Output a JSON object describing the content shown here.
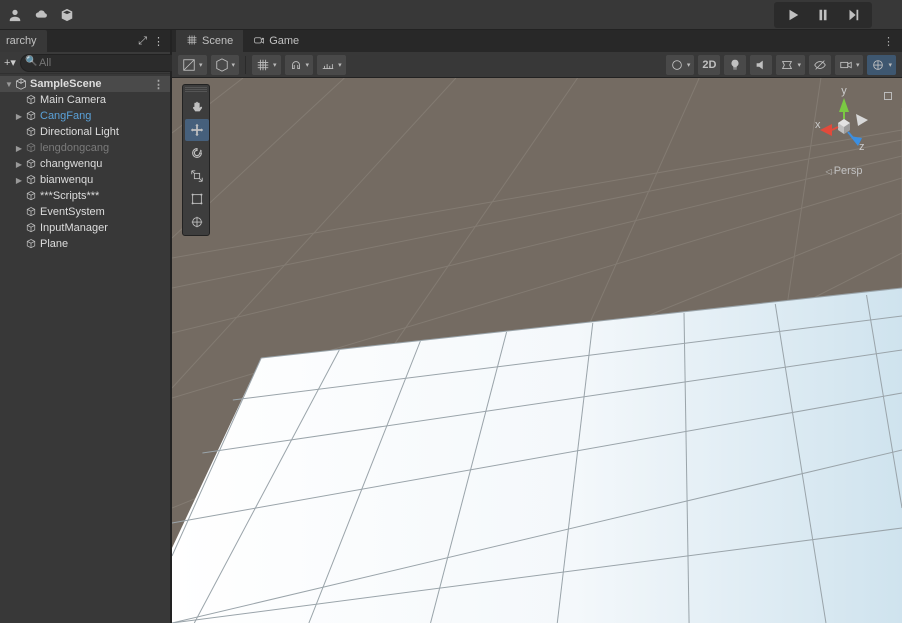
{
  "topbar": {
    "buttons": [
      "account",
      "cloud",
      "package"
    ],
    "play": "play",
    "pause": "pause",
    "step": "step"
  },
  "hierarchy": {
    "tab_label": "rarchy",
    "search_placeholder": "All",
    "scene_name": "SampleScene",
    "items": [
      {
        "label": "Main Camera",
        "state": "normal"
      },
      {
        "label": "CangFang",
        "state": "selected",
        "expandable": true
      },
      {
        "label": "Directional Light",
        "state": "normal"
      },
      {
        "label": "lengdongcang",
        "state": "dim",
        "expandable": true
      },
      {
        "label": "changwenqu",
        "state": "normal",
        "expandable": true
      },
      {
        "label": "bianwenqu",
        "state": "normal",
        "expandable": true
      },
      {
        "label": "***Scripts***",
        "state": "normal"
      },
      {
        "label": "EventSystem",
        "state": "normal"
      },
      {
        "label": "InputManager",
        "state": "normal"
      },
      {
        "label": "Plane",
        "state": "normal"
      }
    ]
  },
  "scene_panel": {
    "tabs": [
      {
        "label": "Scene",
        "active": true
      },
      {
        "label": "Game",
        "active": false
      }
    ],
    "toolbar_2d": "2D",
    "gizmo": {
      "x": "x",
      "y": "y",
      "z": "z",
      "persp": "Persp"
    }
  }
}
